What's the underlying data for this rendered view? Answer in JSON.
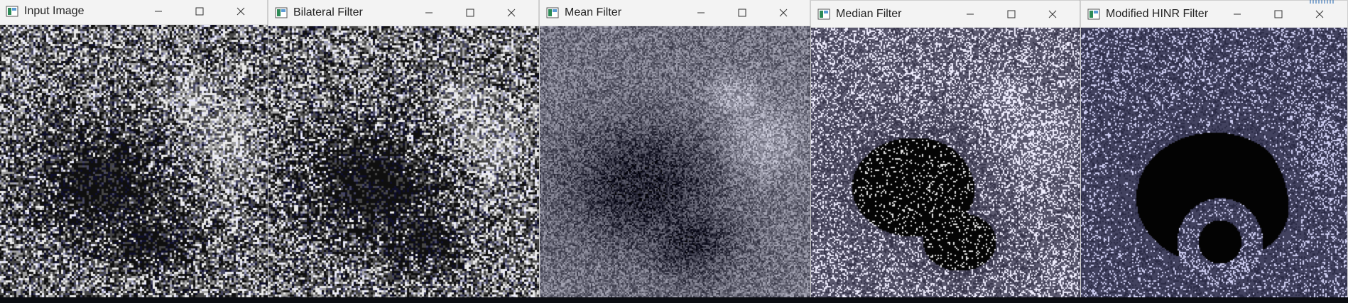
{
  "windows": [
    {
      "title": "Input Image",
      "style": "input"
    },
    {
      "title": "Bilateral Filter",
      "style": "bilateral"
    },
    {
      "title": "Mean Filter",
      "style": "mean"
    },
    {
      "title": "Median Filter",
      "style": "median"
    },
    {
      "title": "Modified HINR Filter",
      "style": "hinr"
    }
  ],
  "colors": {
    "titlebar_bg": "#f3f3f3",
    "title_text": "#222222",
    "icon_green": "#2e8b57",
    "noise_blue": "#6a6fa0"
  },
  "icons": {
    "app_icon": "opencv-window-icon",
    "minimize": "minimize-icon",
    "maximize": "maximize-icon",
    "close": "close-icon"
  }
}
